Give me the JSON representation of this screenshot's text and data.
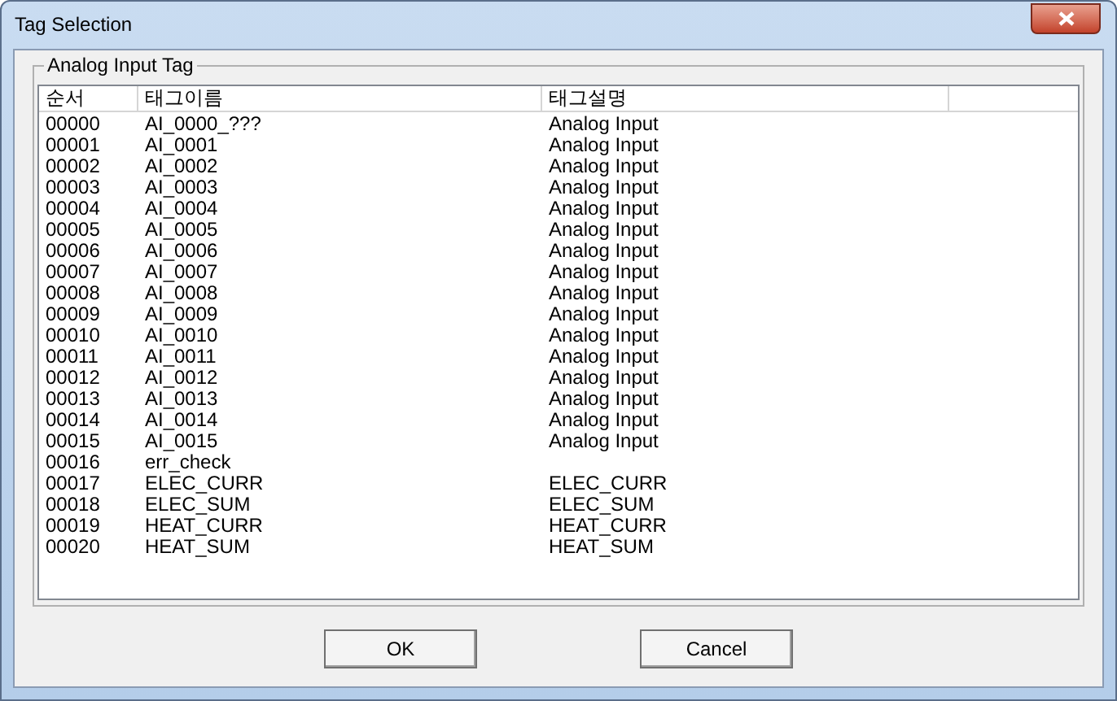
{
  "window": {
    "title": "Tag Selection"
  },
  "group": {
    "label": "Analog Input Tag"
  },
  "table": {
    "columns": [
      "순서",
      "태그이름",
      "태그설명"
    ],
    "rows": [
      [
        "00000",
        "AI_0000_???",
        "Analog Input"
      ],
      [
        "00001",
        "AI_0001",
        "Analog Input"
      ],
      [
        "00002",
        "AI_0002",
        "Analog Input"
      ],
      [
        "00003",
        "AI_0003",
        "Analog Input"
      ],
      [
        "00004",
        "AI_0004",
        "Analog Input"
      ],
      [
        "00005",
        "AI_0005",
        "Analog Input"
      ],
      [
        "00006",
        "AI_0006",
        "Analog Input"
      ],
      [
        "00007",
        "AI_0007",
        "Analog Input"
      ],
      [
        "00008",
        "AI_0008",
        "Analog Input"
      ],
      [
        "00009",
        "AI_0009",
        "Analog Input"
      ],
      [
        "00010",
        "AI_0010",
        "Analog Input"
      ],
      [
        "00011",
        "AI_0011",
        "Analog Input"
      ],
      [
        "00012",
        "AI_0012",
        "Analog Input"
      ],
      [
        "00013",
        "AI_0013",
        "Analog Input"
      ],
      [
        "00014",
        "AI_0014",
        "Analog Input"
      ],
      [
        "00015",
        "AI_0015",
        "Analog Input"
      ],
      [
        "00016",
        "err_check",
        ""
      ],
      [
        "00017",
        "ELEC_CURR",
        "ELEC_CURR"
      ],
      [
        "00018",
        "ELEC_SUM",
        "ELEC_SUM"
      ],
      [
        "00019",
        "HEAT_CURR",
        "HEAT_CURR"
      ],
      [
        "00020",
        "HEAT_SUM",
        "HEAT_SUM"
      ]
    ]
  },
  "buttons": [
    "OK",
    "Cancel"
  ]
}
